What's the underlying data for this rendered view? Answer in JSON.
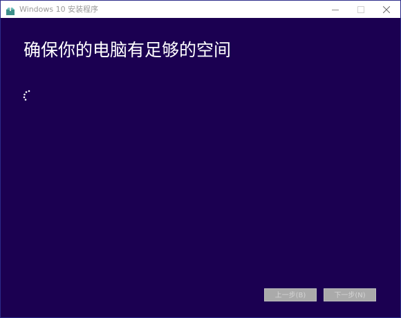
{
  "window": {
    "title": "Windows 10 安装程序",
    "icon": "setup-box-icon",
    "controls": [
      "minimize-icon",
      "maximize-icon",
      "close-icon"
    ]
  },
  "main": {
    "heading": "确保你的电脑有足够的空间",
    "status_icon": "loading-spinner-icon"
  },
  "footer": {
    "back_label": "上一步(B)",
    "next_label": "下一步(N)",
    "back_enabled": false,
    "next_enabled": false
  },
  "colors": {
    "background": "#1b0051",
    "titlebar": "#ffffff",
    "heading_text": "#ffffff",
    "button_disabled_bg": "#aaaaaa",
    "button_disabled_text": "#d4d4d4"
  }
}
